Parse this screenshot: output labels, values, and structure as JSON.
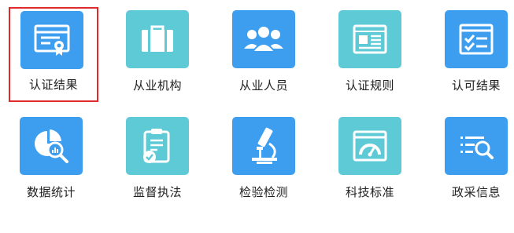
{
  "colors": {
    "blue": "#3d9ef0",
    "teal": "#5ecad6",
    "selected_border": "#e0292a",
    "label_text": "#222222"
  },
  "tiles": [
    {
      "label": "认证结果",
      "icon": "certificate-icon",
      "color": "blue",
      "selected": true
    },
    {
      "label": "从业机构",
      "icon": "briefcase-icon",
      "color": "teal",
      "selected": false
    },
    {
      "label": "从业人员",
      "icon": "people-group-icon",
      "color": "blue",
      "selected": false
    },
    {
      "label": "认证规则",
      "icon": "rules-document-icon",
      "color": "teal",
      "selected": false
    },
    {
      "label": "认可结果",
      "icon": "checklist-window-icon",
      "color": "blue",
      "selected": false
    },
    {
      "label": "数据统计",
      "icon": "statistics-magnifier-icon",
      "color": "blue",
      "selected": false
    },
    {
      "label": "监督执法",
      "icon": "clipboard-check-icon",
      "color": "teal",
      "selected": false
    },
    {
      "label": "检验检测",
      "icon": "microscope-icon",
      "color": "blue",
      "selected": false
    },
    {
      "label": "科技标准",
      "icon": "gauge-window-icon",
      "color": "teal",
      "selected": false
    },
    {
      "label": "政采信息",
      "icon": "list-search-icon",
      "color": "blue",
      "selected": false
    }
  ]
}
